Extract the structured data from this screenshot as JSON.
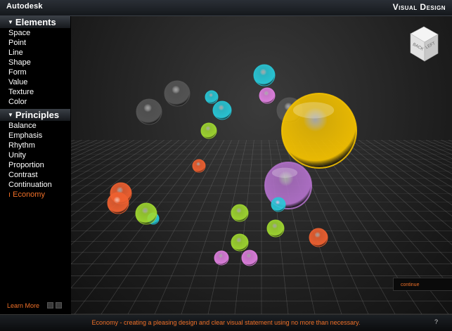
{
  "header": {
    "brand": "Autodesk",
    "title": "Visual Design"
  },
  "sidebar": {
    "elements_heading": "Elements",
    "elements": [
      "Space",
      "Point",
      "Line",
      "Shape",
      "Form",
      "Value",
      "Texture",
      "Color"
    ],
    "principles_heading": "Principles",
    "principles": [
      "Balance",
      "Emphasis",
      "Rhythm",
      "Unity",
      "Proportion",
      "Contrast",
      "Continuation",
      "Economy"
    ],
    "active_item": "Economy",
    "learn_more": "Learn More"
  },
  "viewcube": {
    "front_label": "BACK",
    "side_label": "LEFT"
  },
  "continue_label": "continue",
  "caption": "Economy - creating a pleasing design and clear visual statement using no more than necessary.",
  "help_label": "?",
  "colors": {
    "accent": "#f07028",
    "yellow": "#f2c000",
    "purple": "#b070c8",
    "cyan": "#28c8d8",
    "green": "#a0d830",
    "orange": "#f06030",
    "pink": "#e080e0",
    "gray": "#555555"
  },
  "spheres": [
    {
      "color": "gray",
      "name": "gray-sphere-1"
    },
    {
      "color": "gray",
      "name": "gray-sphere-2"
    },
    {
      "color": "gray",
      "name": "gray-sphere-3"
    },
    {
      "color": "cyan",
      "name": "cyan-sphere-1"
    },
    {
      "color": "cyan",
      "name": "cyan-sphere-2"
    },
    {
      "color": "cyan",
      "name": "cyan-sphere-3"
    },
    {
      "color": "pink",
      "name": "pink-sphere-1"
    },
    {
      "color": "green",
      "name": "green-sphere-1"
    },
    {
      "color": "yellow",
      "name": "yellow-sphere-large"
    },
    {
      "color": "orange",
      "name": "orange-sphere-1"
    },
    {
      "color": "purple",
      "name": "purple-sphere-large"
    },
    {
      "color": "cyan",
      "name": "cyan-sphere-4"
    },
    {
      "color": "orange",
      "name": "orange-sphere-2"
    },
    {
      "color": "orange",
      "name": "orange-sphere-3"
    },
    {
      "color": "cyan",
      "name": "cyan-sphere-5"
    },
    {
      "color": "green",
      "name": "green-sphere-2"
    },
    {
      "color": "green",
      "name": "green-sphere-3"
    },
    {
      "color": "green",
      "name": "green-sphere-4"
    },
    {
      "color": "green",
      "name": "green-sphere-5"
    },
    {
      "color": "orange",
      "name": "orange-sphere-4"
    },
    {
      "color": "pink",
      "name": "pink-sphere-2"
    },
    {
      "color": "pink",
      "name": "pink-sphere-3"
    }
  ]
}
